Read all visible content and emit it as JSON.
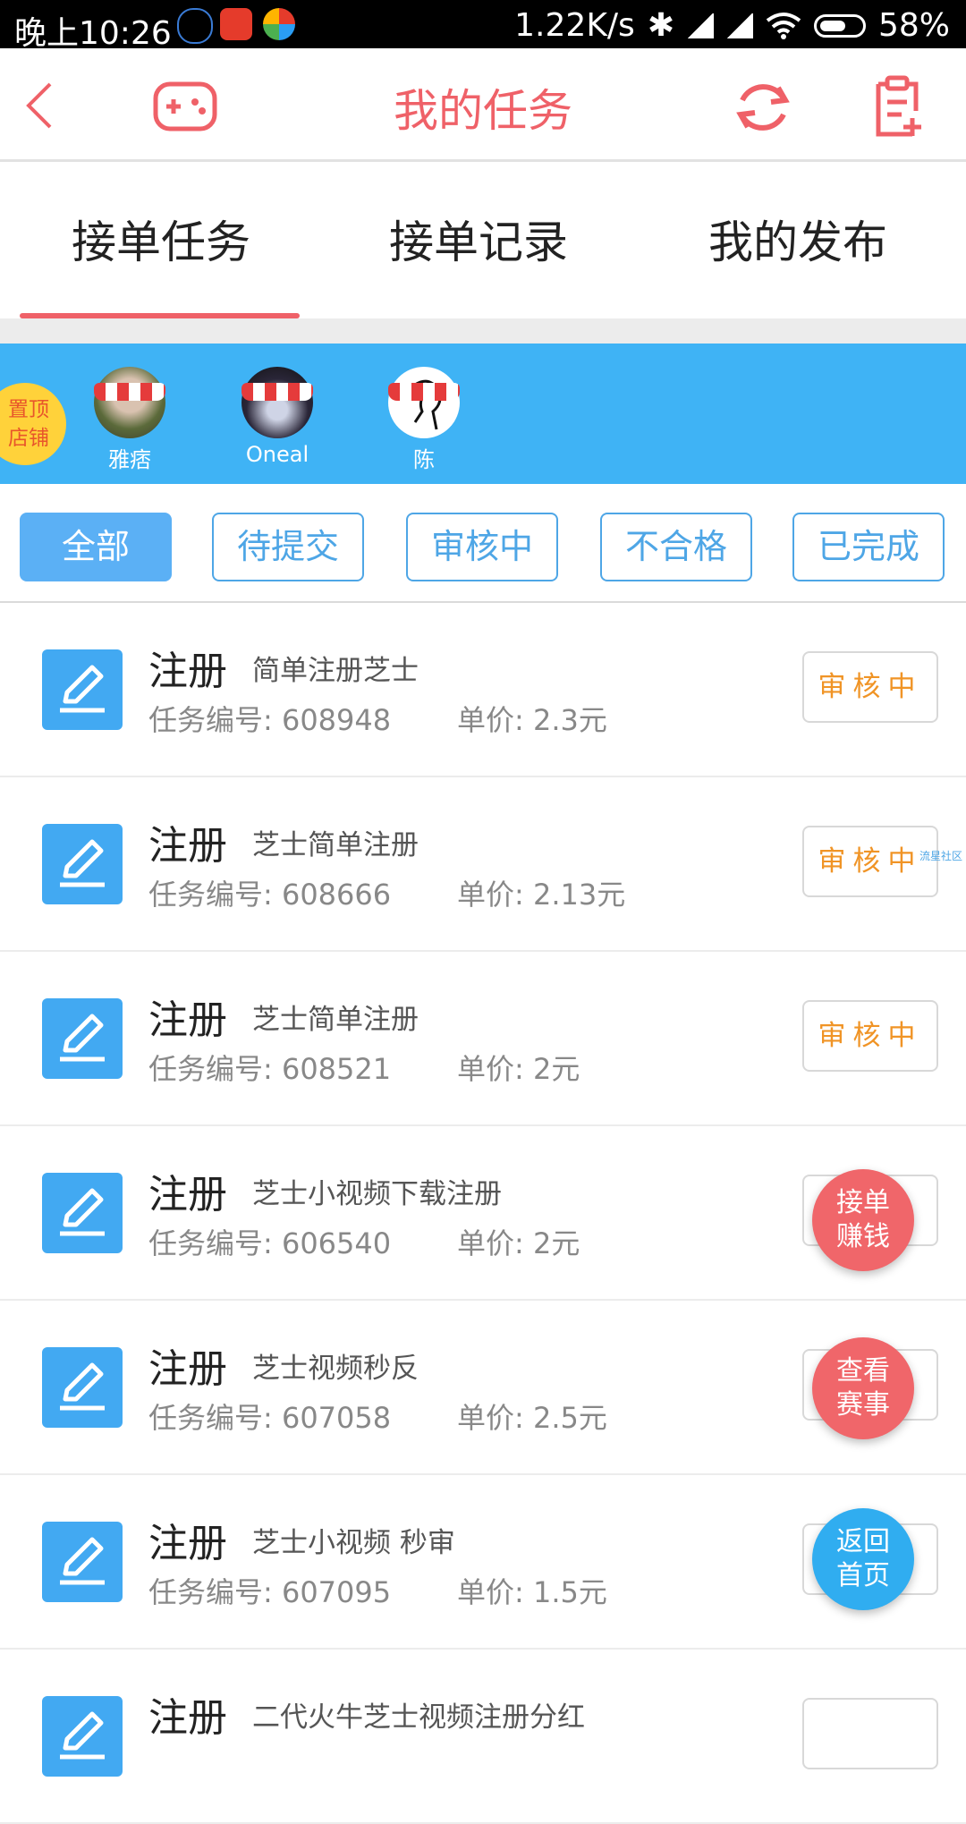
{
  "status_bar": {
    "time": "晚上10:26",
    "network_speed": "1.22K/s",
    "battery": "58%"
  },
  "header": {
    "title": "我的任务"
  },
  "tabs": [
    {
      "label": "接单任务",
      "active": true
    },
    {
      "label": "接单记录",
      "active": false
    },
    {
      "label": "我的发布",
      "active": false
    }
  ],
  "pinned_badge": {
    "line1": "置顶",
    "line2": "店铺"
  },
  "shops": [
    {
      "name": "雅痞"
    },
    {
      "name": "Oneal"
    },
    {
      "name": "陈"
    }
  ],
  "filters": [
    {
      "label": "全部",
      "active": true
    },
    {
      "label": "待提交",
      "active": false
    },
    {
      "label": "审核中",
      "active": false
    },
    {
      "label": "不合格",
      "active": false
    },
    {
      "label": "已完成",
      "active": false
    }
  ],
  "tasks": [
    {
      "type": "注册",
      "name": "简单注册芝士",
      "number_label": "任务编号: 608948",
      "price_label": "单价: 2.3元",
      "status": "审核中"
    },
    {
      "type": "注册",
      "name": "芝士简单注册",
      "number_label": "任务编号: 608666",
      "price_label": "单价: 2.13元",
      "status": "审核中"
    },
    {
      "type": "注册",
      "name": "芝士简单注册",
      "number_label": "任务编号: 608521",
      "price_label": "单价: 2元",
      "status": "审核中"
    },
    {
      "type": "注册",
      "name": "芝士小视频下载注册",
      "number_label": "任务编号: 606540",
      "price_label": "单价: 2元",
      "status": ""
    },
    {
      "type": "注册",
      "name": "芝士视频秒反",
      "number_label": "任务编号: 607058",
      "price_label": "单价: 2.5元",
      "status": ""
    },
    {
      "type": "注册",
      "name": "芝士小视频 秒审",
      "number_label": "任务编号: 607095",
      "price_label": "单价: 1.5元",
      "status": ""
    },
    {
      "type": "注册",
      "name": "二代火牛芝士视频注册分红",
      "number_label": "",
      "price_label": "",
      "status": ""
    }
  ],
  "watermark": "流星社区",
  "fabs": [
    {
      "line1": "接单",
      "line2": "赚钱"
    },
    {
      "line1": "查看",
      "line2": "赛事"
    },
    {
      "line1": "返回",
      "line2": "首页"
    }
  ],
  "colors": {
    "accent_red": "#ef6168",
    "accent_blue": "#3fb3f5",
    "status_orange": "#f09426"
  },
  "icons": {
    "back": "back-arrow-icon",
    "game": "gamepad-icon",
    "refresh": "refresh-icon",
    "publish": "document-add-icon",
    "task": "edit-pencil-icon"
  }
}
